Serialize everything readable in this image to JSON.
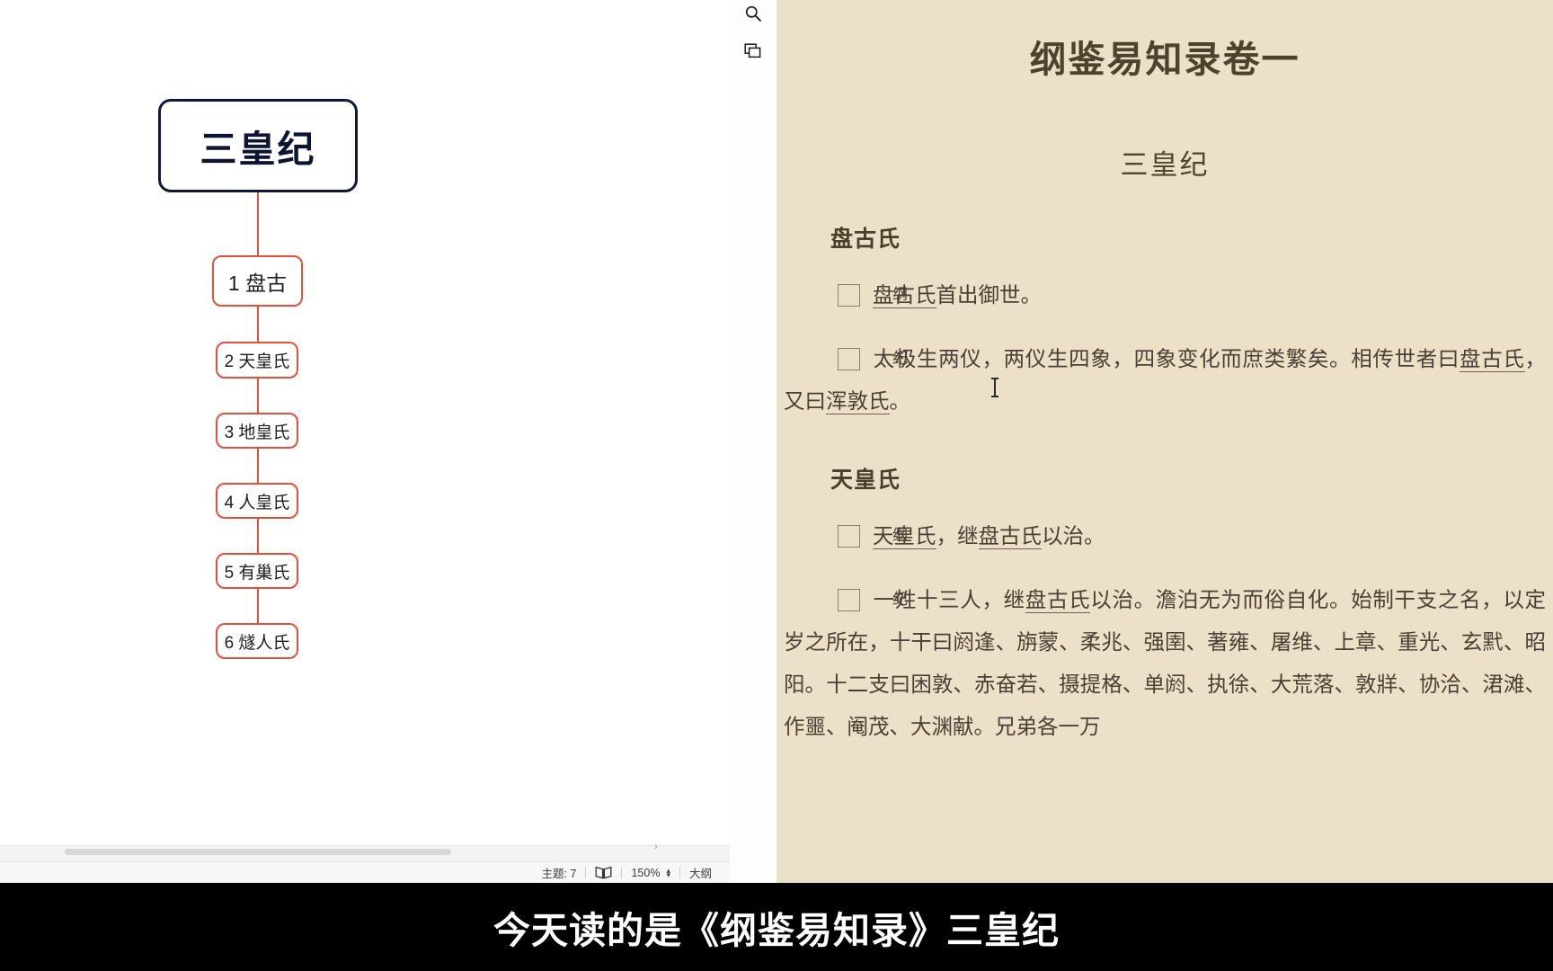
{
  "mindmap": {
    "root": {
      "label": "三皇纪"
    },
    "children": [
      {
        "label": "1 盘古"
      },
      {
        "label": "2 天皇氏"
      },
      {
        "label": "3 地皇氏"
      },
      {
        "label": "4 人皇氏"
      },
      {
        "label": "5 有巢氏"
      },
      {
        "label": "6 燧人氏"
      }
    ],
    "colors": {
      "root_border": "#10183a",
      "child_border": "#e0523f",
      "connector": "#e0523f"
    },
    "statusbar": {
      "topic_count_label": "主题: 7",
      "book_icon": "book-icon",
      "zoom_level": "150%",
      "stepper_up": "▴",
      "stepper_down": "▾",
      "view_mode": "大纲"
    },
    "scroll": {
      "right_arrow": "›"
    }
  },
  "reader": {
    "rail": [
      {
        "name": "search-icon",
        "label": "搜索"
      },
      {
        "name": "window-icon",
        "label": "窗口"
      }
    ],
    "book_title": "纲鉴易知录卷一",
    "chapter_title": "三皇纪",
    "sections": [
      {
        "heading": "盘古氏",
        "paragraphs": [
          {
            "marker": "纲",
            "runs": [
              {
                "t": "盘古氏",
                "kw": true
              },
              {
                "t": "首出御世。",
                "kw": false
              }
            ]
          },
          {
            "marker": "纪",
            "runs": [
              {
                "t": "太极生两仪，两仪生四象，四象变化而庶类繁矣。相传世者曰",
                "kw": false
              },
              {
                "t": "盘古氏",
                "kw": true
              },
              {
                "t": "，又曰",
                "kw": false
              },
              {
                "t": "浑敦氏",
                "kw": true
              },
              {
                "t": "。",
                "kw": false
              }
            ]
          }
        ]
      },
      {
        "heading": "天皇氏",
        "paragraphs": [
          {
            "marker": "纲",
            "runs": [
              {
                "t": "天皇氏",
                "kw": true
              },
              {
                "t": "，继",
                "kw": false
              },
              {
                "t": "盘古氏",
                "kw": true
              },
              {
                "t": "以治。",
                "kw": false
              }
            ]
          },
          {
            "marker": "纪",
            "runs": [
              {
                "t": "一姓十三人，继",
                "kw": false
              },
              {
                "t": "盘古氏",
                "kw": true
              },
              {
                "t": "以治。澹泊无为而俗自化。始制干支之名，以定岁之所在，十干曰阏逢、旃蒙、柔兆、强圉、著雍、屠维、上章、重光、玄黓、昭阳。十二支曰困敦、赤奋若、摄提格、单阏、执徐、大荒落、敦牂、协洽、涒滩、作噩、阉茂、大渊献。兄弟各一万",
                "kw": false
              }
            ]
          }
        ]
      }
    ],
    "colors": {
      "page_bg": "#ece0c8",
      "text": "#4a4034",
      "title": "#4e422d"
    }
  },
  "subtitle": {
    "text": "今天读的是《纲鉴易知录》三皇纪"
  }
}
